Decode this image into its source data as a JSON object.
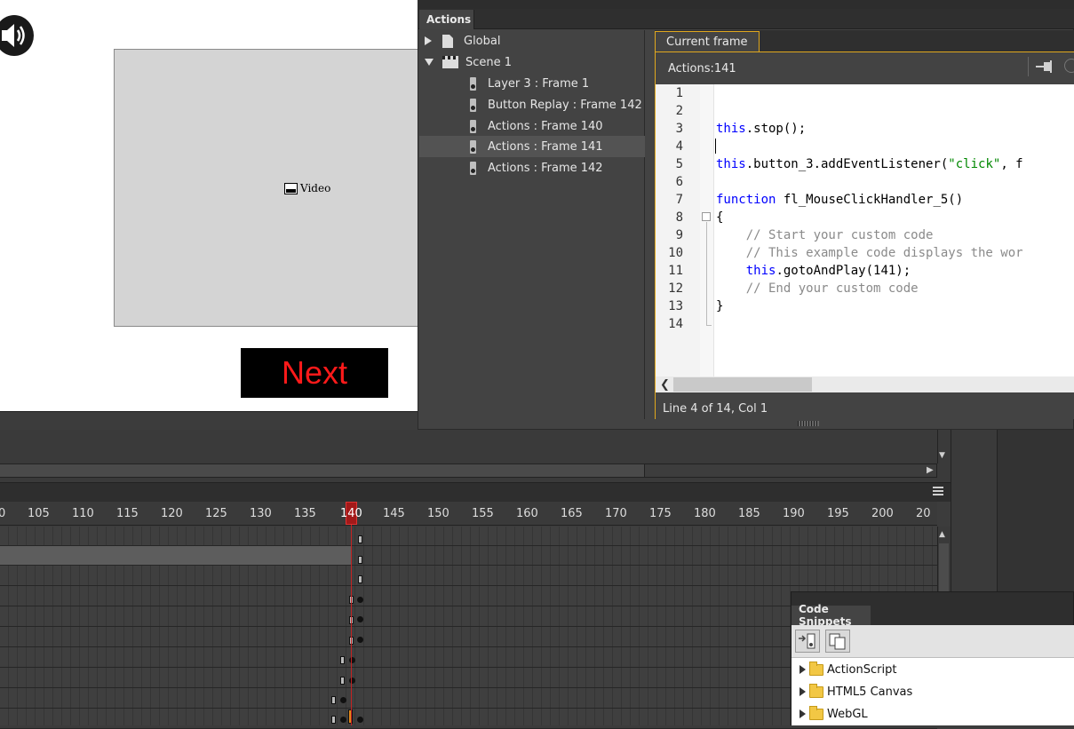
{
  "stage": {
    "video_label": "Video",
    "next_button_label": "Next"
  },
  "actions_panel": {
    "tab_label": "Actions",
    "tree": [
      {
        "label": "Global",
        "level": 0,
        "expanded": false
      },
      {
        "label": "Scene 1",
        "level": 0,
        "expanded": true
      },
      {
        "label": "Layer 3 : Frame 1",
        "level": 1
      },
      {
        "label": "Button Replay : Frame 142",
        "level": 1
      },
      {
        "label": "Actions : Frame 140",
        "level": 1
      },
      {
        "label": "Actions : Frame 141",
        "level": 1,
        "selected": true
      },
      {
        "label": "Actions : Frame 142",
        "level": 1
      }
    ],
    "script_tab_label": "Current frame",
    "script_header": "Actions:141",
    "code_lines": [
      {
        "n": "1",
        "text": ""
      },
      {
        "n": "2",
        "text": ""
      },
      {
        "n": "3",
        "text": "this.stop();"
      },
      {
        "n": "4",
        "text": ""
      },
      {
        "n": "5",
        "text": "this.button_3.addEventListener(\"click\", f"
      },
      {
        "n": "6",
        "text": ""
      },
      {
        "n": "7",
        "text": "function fl_MouseClickHandler_5()"
      },
      {
        "n": "8",
        "text": "{"
      },
      {
        "n": "9",
        "text": "    // Start your custom code"
      },
      {
        "n": "10",
        "text": "    // This example code displays the wor"
      },
      {
        "n": "11",
        "text": "    this.gotoAndPlay(141);"
      },
      {
        "n": "12",
        "text": "    // End your custom code"
      },
      {
        "n": "13",
        "text": "}"
      },
      {
        "n": "14",
        "text": ""
      }
    ],
    "code_tokens": {
      "l3_this": "this",
      "l3_rest": ".stop();",
      "l5_this": "this",
      "l5_mid": ".button_3.addEventListener(",
      "l5_str": "\"click\"",
      "l5_rest": ", f",
      "l7_kw": "function",
      "l7_rest": " fl_MouseClickHandler_5()",
      "l8": "{",
      "l9": "    // Start your custom code",
      "l10": "    // This example code displays the wor",
      "l11_ind": "    ",
      "l11_this": "this",
      "l11_rest": ".gotoAndPlay(141);",
      "l12": "    // End your custom code",
      "l13": "}"
    },
    "status": "Line 4 of 14, Col 1"
  },
  "timeline": {
    "ruler_ticks": [
      "0",
      "105",
      "110",
      "115",
      "120",
      "125",
      "130",
      "135",
      "140",
      "145",
      "150",
      "155",
      "160",
      "165",
      "170",
      "175",
      "180",
      "185",
      "190",
      "195",
      "200",
      "20"
    ],
    "current_frame": 140
  },
  "code_snippets": {
    "tab_label": "Code Snippets",
    "folders": [
      "ActionScript",
      "HTML5 Canvas",
      "WebGL"
    ]
  },
  "icons": {
    "speaker": "speaker-icon",
    "video": "video-icon",
    "global": "document-icon",
    "scene": "clapperboard-icon",
    "frame": "keyframe-icon",
    "pin": "pin-icon",
    "target": "target-icon",
    "folder": "folder-icon",
    "add_to_frame": "add-to-frame-icon",
    "copy_clipboard": "copy-to-clipboard-icon"
  },
  "colors": {
    "accent": "#e1a81e",
    "next_text": "#ff1a1a",
    "keyword": "#0000ff",
    "string": "#008800",
    "comment": "#8a8a8a",
    "playhead": "#c42222"
  }
}
